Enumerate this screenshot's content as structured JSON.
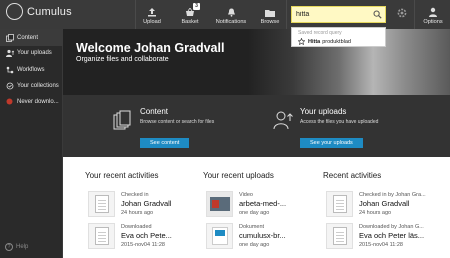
{
  "app": {
    "logo_text": "Cumulus"
  },
  "topnav": {
    "upload": "Upload",
    "basket": "Basket",
    "basket_count": "3",
    "notifications": "Notifications",
    "browse": "Browse",
    "options": "Options"
  },
  "search": {
    "value": "hitta",
    "dropdown_header": "Saved record query",
    "suggestion_bold": "Hitta",
    "suggestion_rest": "produktblad"
  },
  "sidebar": {
    "items": [
      {
        "label": "Content",
        "icon": "stack-icon"
      },
      {
        "label": "Your uploads",
        "icon": "user-upload-icon"
      },
      {
        "label": "Workflows",
        "icon": "workflow-icon"
      },
      {
        "label": "Your collections",
        "icon": "collection-icon"
      },
      {
        "label": "Never downlo...",
        "icon": "red-dot-icon"
      }
    ],
    "help": "Help"
  },
  "hero": {
    "title": "Welcome Johan Gradvall",
    "subtitle": "Organize files and collaborate"
  },
  "panels": {
    "content": {
      "title": "Content",
      "text": "Browse content or search for files",
      "button": "See content"
    },
    "uploads": {
      "title": "Your uploads",
      "text": "Access the files you have uploaded",
      "button": "See your uploads"
    }
  },
  "columns": {
    "activities": {
      "title": "Your recent activities",
      "entries": [
        {
          "l1": "Checked in",
          "l2": "Johan Gradvall",
          "l3": "24 hours ago"
        },
        {
          "l1": "Downloaded",
          "l2": "Eva och Pete...",
          "l3": "2015-nov04 11:28"
        }
      ]
    },
    "uploads": {
      "title": "Your recent uploads",
      "entries": [
        {
          "l1": "Video",
          "l2": "arbeta-med-...",
          "l3": "one day ago"
        },
        {
          "l1": "Dokument",
          "l2": "cumulusx-br...",
          "l3": "one day ago"
        }
      ]
    },
    "recent": {
      "title": "Recent activities",
      "entries": [
        {
          "l1": "Checked in by Johan Gra...",
          "l2": "Johan Gradvall",
          "l3": "24 hours ago"
        },
        {
          "l1": "Downloaded by Johan G...",
          "l2": "Eva och Peter läs...",
          "l3": "2015-nov04 11:28"
        }
      ]
    }
  },
  "colors": {
    "accent": "#1e8bc3",
    "search_bg": "#fff9c4",
    "never_downloaded": "#c0392b"
  }
}
